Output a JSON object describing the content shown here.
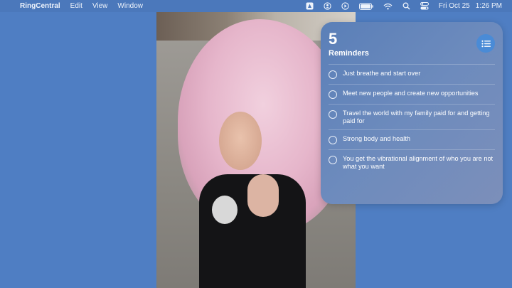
{
  "menubar": {
    "app_name": "RingCentral",
    "menus": [
      "Edit",
      "View",
      "Window"
    ],
    "date": "Fri Oct 25",
    "time": "1:26 PM",
    "icons": [
      "apple-icon",
      "vpn-icon",
      "user-icon",
      "play-icon",
      "battery-icon",
      "wifi-icon",
      "search-icon",
      "control-center-icon"
    ]
  },
  "reminders": {
    "count": "5",
    "title": "Reminders",
    "items": [
      {
        "text": "Just breathe and start over"
      },
      {
        "text": "Meet new people and create new opportunities"
      },
      {
        "text": "Travel the world with my family paid for and getting paid for"
      },
      {
        "text": "Strong body and health"
      },
      {
        "text": "You get the vibrational alignment of who you are not what you want"
      }
    ]
  },
  "colors": {
    "desktop": "#4f7ec3",
    "widget_accent": "#4a8bd6"
  }
}
